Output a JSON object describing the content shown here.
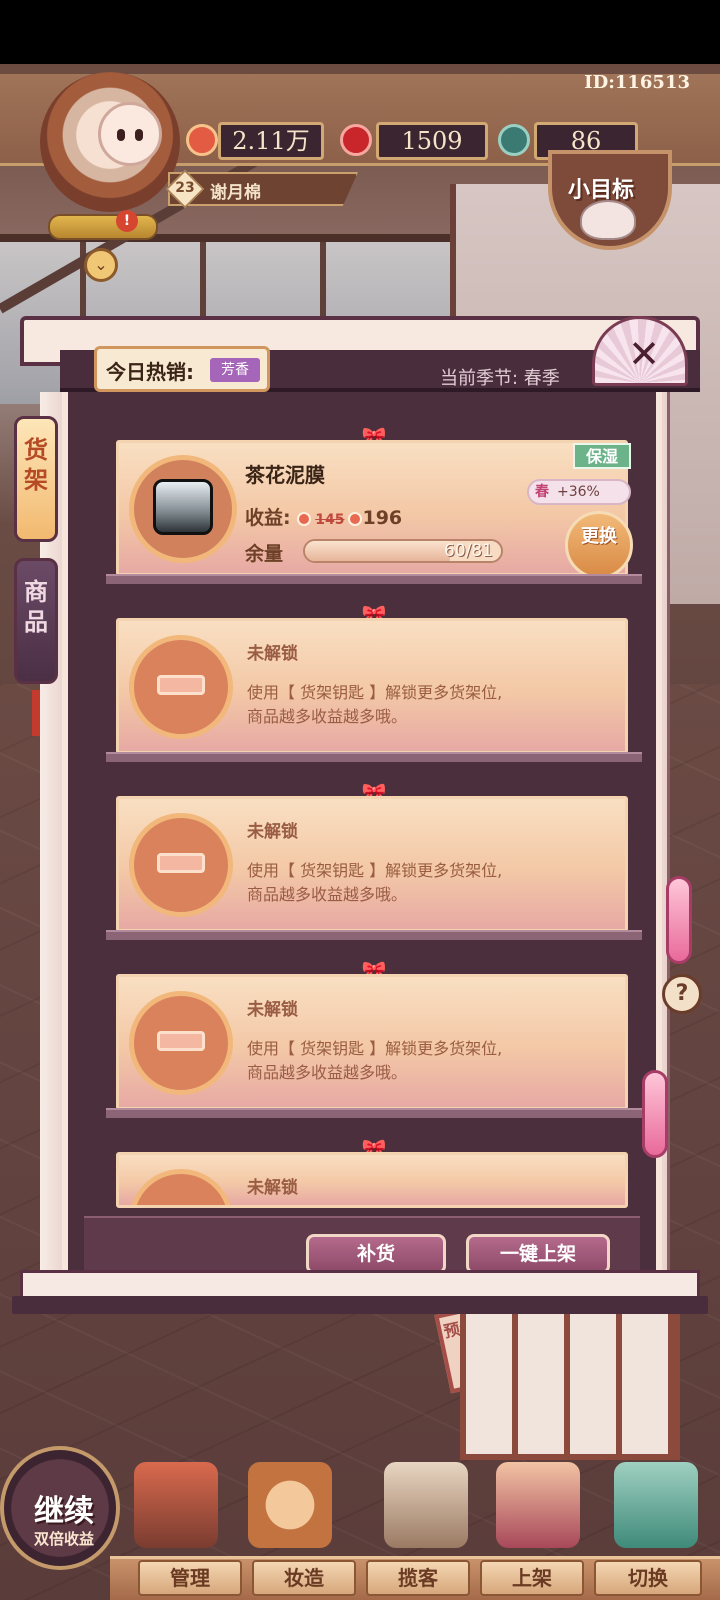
{
  "header": {
    "user_id": "ID:116513",
    "level": "23",
    "player_name": "谢月棉",
    "resources": [
      {
        "icon": "heart-coin-icon",
        "value": "2.11万"
      },
      {
        "icon": "apple-icon",
        "value": "1509"
      },
      {
        "icon": "stamina-icon",
        "value": "86"
      }
    ],
    "goal_label": "小目标",
    "notice_badge": "!"
  },
  "panel": {
    "hot_label": "今日热销:",
    "hot_tag": "芳香",
    "season_label": "当前季节: 春季",
    "tabs": {
      "shelf": "货架",
      "goods": "商品"
    },
    "product": {
      "name": "茶花泥膜",
      "income_label": "收益:",
      "income_old": "145",
      "income_new": "196",
      "stock_label": "余量",
      "stock_text": "60/81",
      "stock_current": 60,
      "stock_max": 81,
      "trait_tag": "保湿",
      "season_tag": "春",
      "season_bonus": "+36%",
      "swap_label": "更换"
    },
    "locked_slots": [
      {
        "title": "未解锁",
        "desc_line1": "使用【 货架钥匙 】解锁更多货架位,",
        "desc_line2": "商品越多收益越多哦。"
      },
      {
        "title": "未解锁",
        "desc_line1": "使用【 货架钥匙 】解锁更多货架位,",
        "desc_line2": "商品越多收益越多哦。"
      },
      {
        "title": "未解锁",
        "desc_line1": "使用【 货架钥匙 】解锁更多货架位,",
        "desc_line2": "商品越多收益越多哦。"
      },
      {
        "title": "未解锁"
      }
    ],
    "restock_label": "补货",
    "auto_shelf_label": "一键上架",
    "help_label": "?"
  },
  "bottom": {
    "continue_title": "继续",
    "continue_sub": "双倍收益",
    "nav": [
      "管理",
      "妆造",
      "揽客",
      "上架",
      "切换"
    ]
  },
  "scene": {
    "sign_text": "预约牌"
  },
  "colors": {
    "accent": "#c8332b",
    "panel_bg": "#4b2f3c",
    "shelf_bg": "#f3c8a6",
    "active_tab": "#f2b970"
  }
}
